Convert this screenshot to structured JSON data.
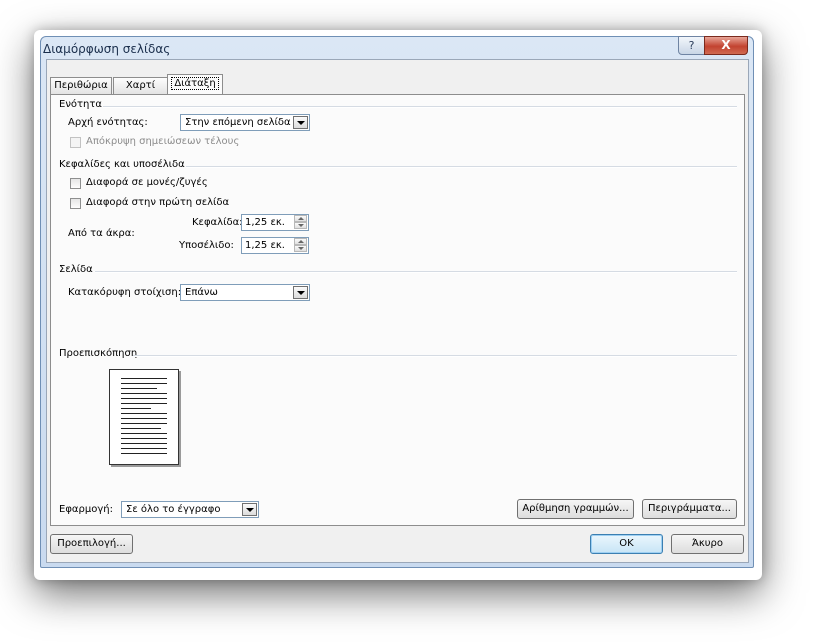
{
  "window": {
    "title": "Διαμόρφωση σελίδας",
    "help_label": "?",
    "close_label": "X"
  },
  "tabs": [
    {
      "label": "Περιθώρια",
      "active": false
    },
    {
      "label": "Χαρτί",
      "active": false
    },
    {
      "label": "Διάταξη",
      "active": true
    }
  ],
  "section_group": {
    "title": "Ενότητα",
    "section_start_label": "Αρχή ενότητας:",
    "section_start_value": "Στην επόμενη σελίδα",
    "suppress_endnotes_label": "Απόκρυψη σημειώσεων τέλους",
    "suppress_endnotes_checked": false,
    "suppress_endnotes_enabled": false
  },
  "headers_group": {
    "title": "Κεφαλίδες και υποσέλιδα",
    "odd_even_label": "Διαφορά σε μονές/ζυγές",
    "odd_even_checked": false,
    "first_page_label": "Διαφορά στην πρώτη σελίδα",
    "first_page_checked": false,
    "from_edge_label": "Από τα άκρα:",
    "header_label": "Κεφαλίδα:",
    "header_value": "1,25 εκ.",
    "footer_label": "Υποσέλιδο:",
    "footer_value": "1,25 εκ."
  },
  "page_group": {
    "title": "Σελίδα",
    "vertical_alignment_label": "Κατακόρυφη στοίχιση:",
    "vertical_alignment_value": "Επάνω"
  },
  "preview": {
    "title": "Προεπισκόπηση",
    "apply_to_label": "Εφαρμογή:",
    "apply_to_value": "Σε όλο το έγγραφο",
    "line_numbers_button": "Αρίθμηση γραμμών...",
    "borders_button": "Περιγράμματα..."
  },
  "footer": {
    "default_button": "Προεπιλογή...",
    "ok_button": "OK",
    "cancel_button": "Άκυρο"
  },
  "colors": {
    "dialog_bg": "#f0f0f0",
    "title_text": "#1b2f4d",
    "close_button": "#c24330",
    "frame": "#dbe7f5"
  }
}
